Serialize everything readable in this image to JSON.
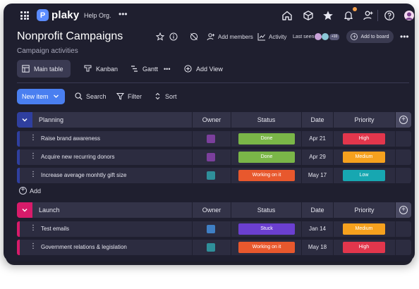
{
  "app": {
    "name": "plaky",
    "org": "Help Org.",
    "logo_letter": "P",
    "brand_color": "#5b8cff"
  },
  "top_icons": [
    "home-icon",
    "cube-icon",
    "star-icon",
    "bell-icon",
    "person-add-icon",
    "help-icon"
  ],
  "board": {
    "title": "Nonprofit Campaigns",
    "subtitle": "Campaign activities",
    "add_members_label": "Add members",
    "activity_label": "Activity",
    "last_seen_label": "Last seen",
    "last_seen_count": "+10",
    "add_to_board_label": "Add to board"
  },
  "views": {
    "main_table": "Main table",
    "kanban": "Kanban",
    "gantt": "Gantt",
    "add_view": "Add View"
  },
  "toolbar": {
    "new_item": "New item",
    "search": "Search",
    "filter": "Filter",
    "sort": "Sort"
  },
  "columns": {
    "owner": "Owner",
    "status": "Status",
    "date": "Date",
    "priority": "Priority"
  },
  "colors": {
    "done": "#7ab648",
    "working": "#e8582d",
    "stuck": "#6b3fd0",
    "high": "#e2364c",
    "medium": "#f6a11e",
    "low": "#17a7b1",
    "planning": "#2f3f9f",
    "launch": "#d81b6a"
  },
  "groups": [
    {
      "name": "Planning",
      "color": "#2f3f9f",
      "rows": [
        {
          "name": "Raise brand awareness",
          "status": "Done",
          "date": "Apr 21",
          "priority": "High"
        },
        {
          "name": "Acquire new recurring donors",
          "status": "Done",
          "date": "Apr 29",
          "priority": "Medium"
        },
        {
          "name": "Increase average monhtly gift size",
          "status": "Working on it",
          "date": "May 17",
          "priority": "Low"
        }
      ],
      "add_label": "Add"
    },
    {
      "name": "Launch",
      "color": "#d81b6a",
      "rows": [
        {
          "name": "Test emails",
          "status": "Stuck",
          "date": "Jan 14",
          "priority": "Medium"
        },
        {
          "name": "Government relations & legislation",
          "status": "Working on it",
          "date": "May 18",
          "priority": "High"
        }
      ]
    }
  ]
}
